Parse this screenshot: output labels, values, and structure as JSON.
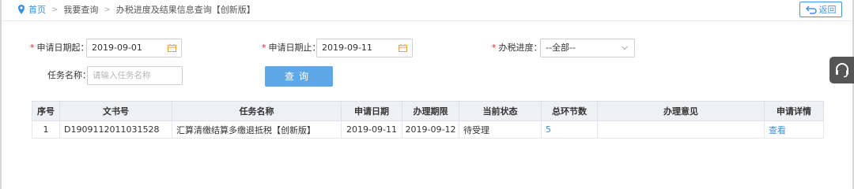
{
  "breadcrumb": {
    "home": "首页",
    "level1": "我要查询",
    "level2": "办税进度及结果信息查询【创新版】",
    "separator": ">"
  },
  "back_button": {
    "label": "返回"
  },
  "filters": {
    "start_date": {
      "label": "申请日期起：",
      "value": "2019-09-01"
    },
    "end_date": {
      "label": "申请日期止：",
      "value": "2019-09-11"
    },
    "progress": {
      "label": "办税进度：",
      "value": "--全部--"
    },
    "task_name": {
      "label": "任务名称：",
      "placeholder": "请输入任务名称"
    },
    "required_mark": "*"
  },
  "query_button": {
    "label": "查询"
  },
  "table": {
    "headers": [
      "序号",
      "文书号",
      "任务名称",
      "申请日期",
      "办理期限",
      "当前状态",
      "总环节数",
      "办理意见",
      "申请详情"
    ],
    "rows": [
      {
        "index": "1",
        "doc_no": "D1909112011031528",
        "task_name": "汇算清缴结算多缴退抵税【创新版】",
        "apply_date": "2019-09-11",
        "deadline": "2019-09-12",
        "status": "待受理",
        "total_steps": "5",
        "opinion": "",
        "detail": "查看"
      }
    ]
  },
  "colors": {
    "accent": "#3b8fd9",
    "button": "#5ea8e8",
    "required": "#e02020",
    "header_bg": "#eef0f3",
    "support_bg": "#555555"
  },
  "icons": {
    "breadcrumb": "location-pin-icon",
    "back": "return-arrow-icon",
    "date": "calendar-icon",
    "select": "chevron-down-icon",
    "support": "headset-icon"
  }
}
